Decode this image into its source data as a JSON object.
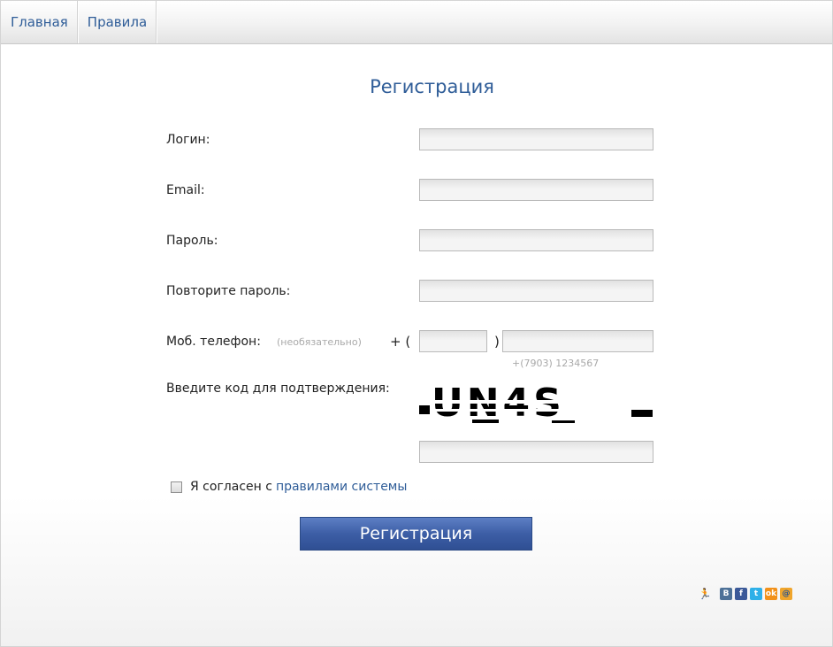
{
  "nav": {
    "items": [
      {
        "label": "Главная"
      },
      {
        "label": "Правила"
      }
    ]
  },
  "form": {
    "title": "Регистрация",
    "login_label": "Логин:",
    "login_value": "",
    "email_label": "Email:",
    "email_value": "",
    "password_label": "Пароль:",
    "password_value": "",
    "password_repeat_label": "Повторите пароль:",
    "password_repeat_value": "",
    "phone_label": "Моб. телефон:",
    "phone_optional": "(необязательно)",
    "phone_prefix": "+ (",
    "phone_close": ")",
    "phone_code_value": "",
    "phone_number_value": "",
    "phone_example": "+(7903) 1234567",
    "captcha_label": "Введите код для подтверждения:",
    "captcha_text": "UN4S",
    "captcha_value": "",
    "agree_text": "Я согласен с",
    "agree_link": "правилами системы",
    "agree_checked": false,
    "submit_label": "Регистрация"
  },
  "social": {
    "icons": [
      {
        "name": "runner-icon",
        "glyph": "🏃"
      },
      {
        "name": "vk-icon",
        "glyph": "B"
      },
      {
        "name": "facebook-icon",
        "glyph": "f"
      },
      {
        "name": "twitter-icon",
        "glyph": "t"
      },
      {
        "name": "odnoklassniki-icon",
        "glyph": "ok"
      },
      {
        "name": "mailru-icon",
        "glyph": "@"
      }
    ]
  },
  "colors": {
    "link": "#2f5d98",
    "button": "#3d5ea6",
    "muted": "#a9a9a9"
  }
}
